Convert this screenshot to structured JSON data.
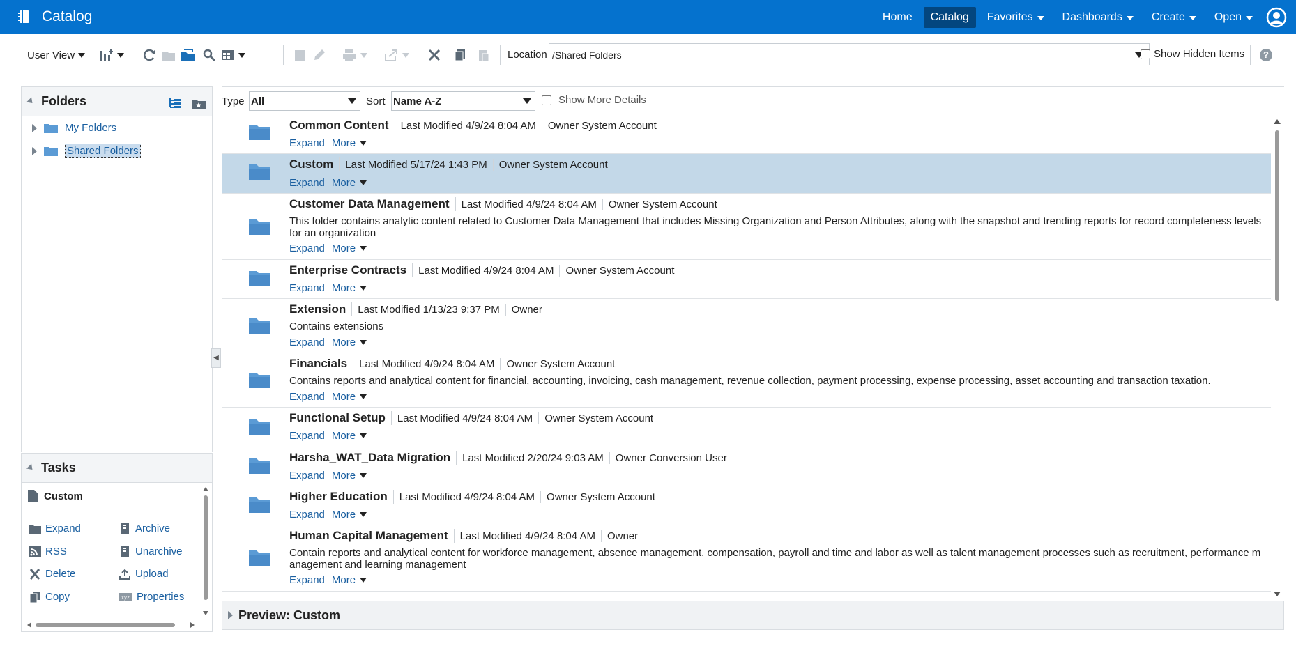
{
  "header": {
    "app_title": "Catalog",
    "nav": [
      {
        "label": "Home",
        "dropdown": false,
        "active": false
      },
      {
        "label": "Catalog",
        "dropdown": false,
        "active": true
      },
      {
        "label": "Favorites",
        "dropdown": true,
        "active": false
      },
      {
        "label": "Dashboards",
        "dropdown": true,
        "active": false
      },
      {
        "label": "Create",
        "dropdown": true,
        "active": false
      },
      {
        "label": "Open",
        "dropdown": true,
        "active": false
      }
    ]
  },
  "toolbar": {
    "view_label": "User View",
    "location_label": "Location",
    "location_value": "/Shared Folders",
    "show_hidden_label": "Show Hidden Items",
    "help_glyph": "?"
  },
  "folders": {
    "title": "Folders",
    "items": [
      {
        "label": "My Folders"
      },
      {
        "label": "Shared Folders",
        "selected": true
      }
    ]
  },
  "tasks": {
    "title": "Tasks",
    "selected_item": "Custom",
    "actions": [
      "Expand",
      "Archive",
      "RSS",
      "Unarchive",
      "Delete",
      "Upload",
      "Copy",
      "Properties"
    ]
  },
  "filter": {
    "type_label": "Type",
    "type_value": "All",
    "sort_label": "Sort",
    "sort_value": "Name A-Z",
    "show_more_label": "Show More Details"
  },
  "list": {
    "expand_label": "Expand",
    "more_label": "More",
    "items": [
      {
        "name": "Common Content",
        "modified": "Last Modified 4/9/24 8:04 AM",
        "owner": "Owner System Account",
        "description": ""
      },
      {
        "name": "Custom",
        "modified": "Last Modified 5/17/24 1:43 PM",
        "owner": "Owner System Account",
        "description": "",
        "selected": true
      },
      {
        "name": "Customer Data Management",
        "modified": "Last Modified 4/9/24 8:04 AM",
        "owner": "Owner System Account",
        "description": "This folder contains analytic content related to Customer Data Management that includes Missing Organization and Person Attributes, along with the snapshot and trending reports for record completeness levels for an organization"
      },
      {
        "name": "Enterprise Contracts",
        "modified": "Last Modified 4/9/24 8:04 AM",
        "owner": "Owner System Account",
        "description": ""
      },
      {
        "name": "Extension",
        "modified": "Last Modified 1/13/23 9:37 PM",
        "owner": "Owner",
        "description": "Contains extensions"
      },
      {
        "name": "Financials",
        "modified": "Last Modified 4/9/24 8:04 AM",
        "owner": "Owner System Account",
        "description": "Contains reports and analytical content for financial, accounting, invoicing, cash management, revenue collection, payment processing, expense processing, asset accounting and transaction taxation."
      },
      {
        "name": "Functional Setup",
        "modified": "Last Modified 4/9/24 8:04 AM",
        "owner": "Owner System Account",
        "description": ""
      },
      {
        "name": "Harsha_WAT_Data Migration",
        "modified": "Last Modified 2/20/24 9:03 AM",
        "owner": "Owner Conversion User",
        "description": ""
      },
      {
        "name": "Higher Education",
        "modified": "Last Modified 4/9/24 8:04 AM",
        "owner": "Owner System Account",
        "description": ""
      },
      {
        "name": "Human Capital Management",
        "modified": "Last Modified 4/9/24 8:04 AM",
        "owner": "Owner",
        "description": "Contain reports and analytical content for workforce management, absence management, compensation, payroll and time and labor as well as talent management processes such as recruitment, performance m anagement and learning management"
      }
    ]
  },
  "preview": {
    "label": "Preview: Custom"
  },
  "colors": {
    "header_bg": "#0572ce",
    "header_active": "#03467f",
    "link": "#1a5fa0",
    "selected_row": "#c3d8e8",
    "folder_icon": "#5b9bd5"
  }
}
